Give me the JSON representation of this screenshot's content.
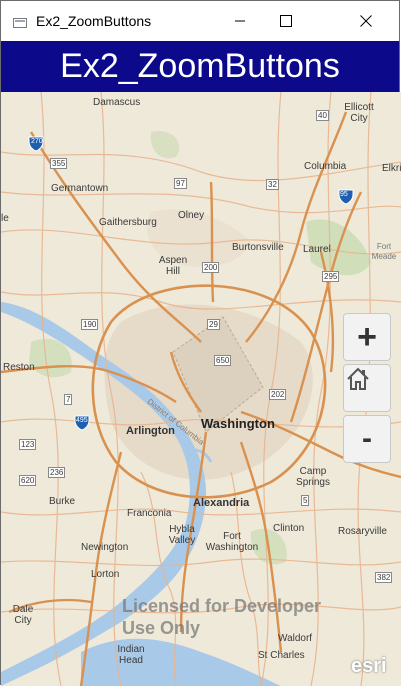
{
  "window": {
    "title": "Ex2_ZoomButtons",
    "controls": [
      "minimize",
      "maximize",
      "close"
    ]
  },
  "header": {
    "title": "Ex2_ZoomButtons"
  },
  "map": {
    "places": {
      "damascus": "Damascus",
      "ellicott_city": "Ellicott City",
      "germantown": "Germantown",
      "columbia": "Columbia",
      "elkridge": "Elkri",
      "gaithersburg": "Gaithersburg",
      "olney": "Olney",
      "burtonsville": "Burtonsville",
      "laurel": "Laurel",
      "fort_meade": "Fort Meade",
      "aspen_hill": "Aspen Hill",
      "reston": "Reston",
      "arlington": "Arlington",
      "washington": "Washington",
      "district": "District of Columbia",
      "camp_springs": "Camp Springs",
      "burke": "Burke",
      "franconia": "Franconia",
      "alexandria": "Alexandria",
      "clinton": "Clinton",
      "rosaryville": "Rosaryville",
      "hybla_valley": "Hybla Valley",
      "fort_washington": "Fort Washington",
      "newington": "Newington",
      "lorton": "Lorton",
      "dale_city": "Dale City",
      "indian_head": "Indian Head",
      "waldorf": "Waldorf",
      "st_charles": "St Charles",
      "edge_le": "le"
    },
    "shields": {
      "s270": "270",
      "s355": "355",
      "s40": "40",
      "s97": "97",
      "s32": "32",
      "s95": "95",
      "s200": "200",
      "s295": "295",
      "s190": "190",
      "s29": "29",
      "s650": "650",
      "s202": "202",
      "s7": "7",
      "s495": "495",
      "s123": "123",
      "s620": "620",
      "s236": "236",
      "s5": "5",
      "s382": "382"
    },
    "watermark_line1": "Licensed for Developer",
    "watermark_line2": "Use Only",
    "attribution": "esri"
  },
  "controls": {
    "zoom_in_label": "+",
    "home_icon": "home-icon",
    "zoom_out_label": "-"
  },
  "colors": {
    "header_bg": "#0c0a8a",
    "header_text": "#ffffff",
    "map_land": "#efe9d9",
    "map_urban": "#e4d6c4",
    "roads": "#e6a77c",
    "highways": "#d9914f",
    "water": "#a9c9e8",
    "parks": "#c9dbb1"
  }
}
